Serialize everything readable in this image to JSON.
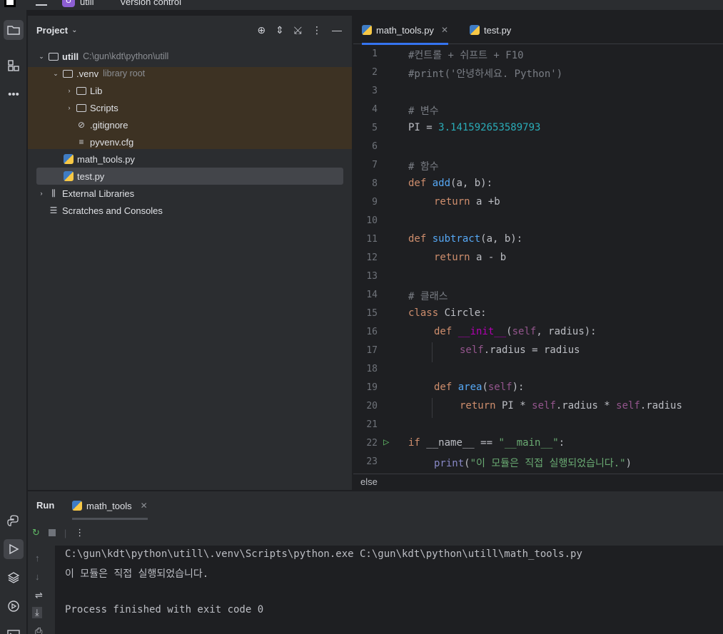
{
  "topbar": {
    "project_badge": "U",
    "project_name": "utill",
    "version_control": "Version control"
  },
  "left_strip": {
    "icons": [
      "folder-icon",
      "structure-icon",
      "more-icon",
      "python-console-icon",
      "run-icon",
      "layers-icon",
      "services-icon",
      "terminal-icon"
    ]
  },
  "project_panel": {
    "title": "Project",
    "tree": [
      {
        "label": "utill",
        "hint": "C:\\gun\\kdt\\python\\utill"
      },
      {
        "label": ".venv",
        "hint": "library root"
      },
      {
        "label": "Lib"
      },
      {
        "label": "Scripts"
      },
      {
        "label": ".gitignore"
      },
      {
        "label": "pyvenv.cfg"
      },
      {
        "label": "math_tools.py"
      },
      {
        "label": "test.py"
      },
      {
        "label": "External Libraries"
      },
      {
        "label": "Scratches and Consoles"
      }
    ]
  },
  "editor": {
    "tabs": [
      {
        "label": "math_tools.py",
        "active": true
      },
      {
        "label": "test.py",
        "active": false
      }
    ],
    "line_numbers": [
      "1",
      "2",
      "3",
      "4",
      "5",
      "6",
      "7",
      "8",
      "9",
      "10",
      "11",
      "12",
      "13",
      "14",
      "15",
      "16",
      "17",
      "18",
      "19",
      "20",
      "21",
      "22",
      "23"
    ],
    "code": {
      "l1": "#컨트롤 + 쉬프트 + F10",
      "l2": "#print('안녕하세요. Python')",
      "l4": "# 변수",
      "l5_a": "PI = ",
      "l5_b": "3.141592653589793",
      "l7": "# 함수",
      "l8_kw": "def ",
      "l8_fn": "add",
      "l8_rest": "(a, b):",
      "l9_kw": "return",
      "l9_rest": " a +b",
      "l11_kw": "def ",
      "l11_fn": "subtract",
      "l11_rest": "(a, b):",
      "l12_kw": "return",
      "l12_rest": " a - b",
      "l14": "# 클래스",
      "l15_kw": "class ",
      "l15_rest": "Circle:",
      "l16_kw": "def ",
      "l16_fn": "__init__",
      "l16_p1": "(",
      "l16_self": "self",
      "l16_rest": ", radius):",
      "l17_self": "self",
      "l17_rest": ".radius = radius",
      "l19_kw": "def ",
      "l19_fn": "area",
      "l19_p1": "(",
      "l19_self": "self",
      "l19_rest": "):",
      "l20_kw": "return",
      "l20_a": " PI * ",
      "l20_self1": "self",
      "l20_b": ".radius * ",
      "l20_self2": "self",
      "l20_c": ".radius",
      "l22_kw": "if ",
      "l22_a": "__name__ == ",
      "l22_str": "\"__main__\"",
      "l22_b": ":",
      "l23_fn": "print",
      "l23_p": "(",
      "l23_str": "\"이 모듈은 직접 실행되었습니다.\"",
      "l23_end": ")"
    },
    "breadcrumb": "else"
  },
  "run_panel": {
    "label": "Run",
    "tab": "math_tools",
    "console": [
      "C:\\gun\\kdt\\python\\utill\\.venv\\Scripts\\python.exe C:\\gun\\kdt\\python\\utill\\math_tools.py",
      "이 모듈은 직접 실행되었습니다.",
      "",
      "Process finished with exit code 0"
    ]
  }
}
